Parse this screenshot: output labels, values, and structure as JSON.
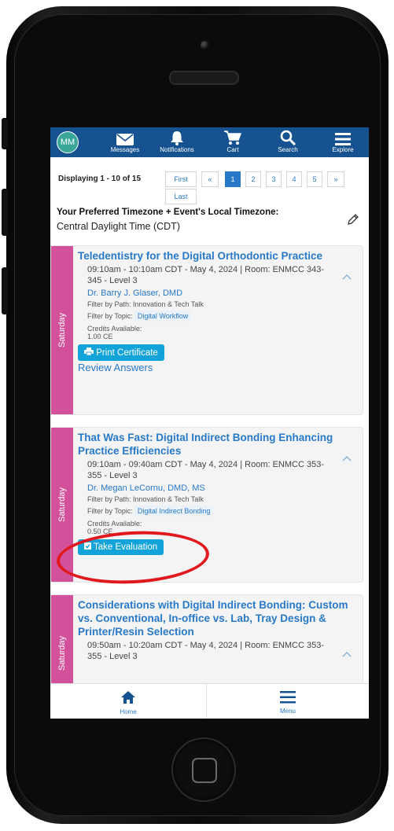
{
  "user": {
    "initials": "MM"
  },
  "nav": {
    "messages": "Messages",
    "notifications": "Notifications",
    "cart": "Cart",
    "search": "Search",
    "explore": "Explore"
  },
  "pager": {
    "displaying": "Displaying 1 - 10 of 15",
    "first": "First",
    "prev": "«",
    "pages": [
      "1",
      "2",
      "3",
      "4",
      "5"
    ],
    "active_page": "1",
    "next": "»",
    "last": "Last"
  },
  "timezone": {
    "label": "Your Preferred Timezone + Event's Local Timezone:",
    "value": "Central Daylight Time (CDT)"
  },
  "sessions": [
    {
      "day": "Saturday",
      "title": "Teledentistry for the Digital Orthodontic Practice",
      "time_room": "09:10am - 10:10am CDT - May 4, 2024 | Room: ENMCC 343-345 - Level 3",
      "speaker": "Dr. Barry J. Glaser, DMD",
      "path": "Filter by Path: Innovation & Tech Talk",
      "topic_label": "Filter by Topic:",
      "topic": "Digital Workflow",
      "credits_label": "Credits Available:",
      "credits": "1.00 CE",
      "button": "Print Certificate",
      "link": "Review Answers"
    },
    {
      "day": "Saturday",
      "title": "That Was Fast: Digital Indirect Bonding Enhancing Practice Efficiencies",
      "time_room": "09:10am - 09:40am CDT - May 4, 2024 | Room: ENMCC 353-355 - Level 3",
      "speaker": "Dr. Megan LeCornu, DMD, MS",
      "path": "Filter by Path: Innovation & Tech Talk",
      "topic_label": "Filter by Topic:",
      "topic": "Digital Indirect Bonding",
      "credits_label": "Credits Available:",
      "credits": "0.50 CE",
      "button": "Take Evaluation"
    },
    {
      "day": "Saturday",
      "title": "Considerations with Digital Indirect Bonding: Custom vs. Conventional, In-office vs. Lab, Tray Design & Printer/Resin Selection",
      "time_room": "09:50am - 10:20am CDT - May 4, 2024 | Room: ENMCC 353-355 - Level 3"
    }
  ],
  "bottom_nav": {
    "home": "Home",
    "menu": "Menu"
  },
  "colors": {
    "header": "#16528f",
    "accent": "#2879c7",
    "day_strip": "#d3519a",
    "button": "#12a3d8",
    "annotation": "#e0191f"
  }
}
